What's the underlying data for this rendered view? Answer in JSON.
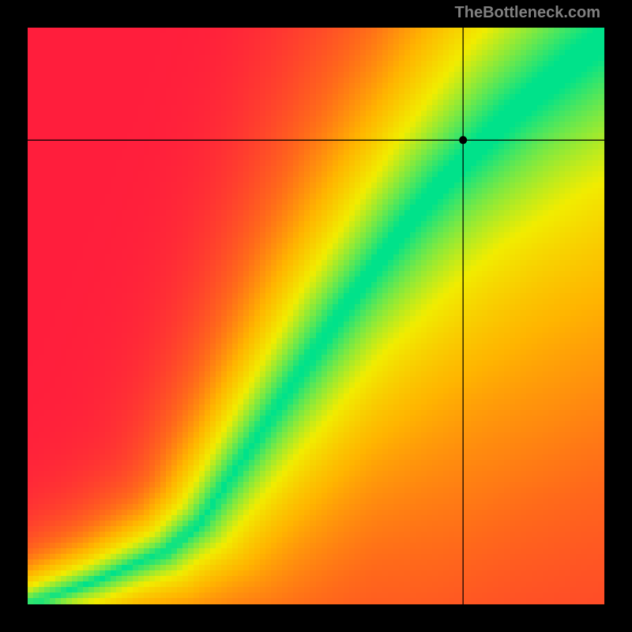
{
  "watermark": "TheBottleneck.com",
  "chart_data": {
    "type": "heatmap",
    "title": "",
    "xlabel": "",
    "ylabel": "",
    "xlim": [
      0,
      100
    ],
    "ylim": [
      0,
      100
    ],
    "crosshair": {
      "x": 75.5,
      "y": 80.5
    },
    "marker": {
      "x": 75.5,
      "y": 80.5
    },
    "optimal_curve_description": "Green optimal band runs diagonally from lower-left to upper-right; narrow at the bottom, widening toward the top. Field grades from red (far from band) through orange/yellow to green (on band).",
    "optimal_curve_points": [
      {
        "x": 0,
        "y": 0
      },
      {
        "x": 6,
        "y": 2
      },
      {
        "x": 12,
        "y": 4
      },
      {
        "x": 18,
        "y": 6.5
      },
      {
        "x": 24,
        "y": 9
      },
      {
        "x": 30,
        "y": 14
      },
      {
        "x": 36,
        "y": 23
      },
      {
        "x": 42,
        "y": 32
      },
      {
        "x": 48,
        "y": 41
      },
      {
        "x": 54,
        "y": 50
      },
      {
        "x": 60,
        "y": 58
      },
      {
        "x": 66,
        "y": 66
      },
      {
        "x": 72,
        "y": 73
      },
      {
        "x": 78,
        "y": 79
      },
      {
        "x": 84,
        "y": 85
      },
      {
        "x": 90,
        "y": 90
      },
      {
        "x": 96,
        "y": 95
      },
      {
        "x": 100,
        "y": 98
      }
    ],
    "band_half_width_points": [
      {
        "x": 0,
        "w": 0.6
      },
      {
        "x": 10,
        "w": 0.9
      },
      {
        "x": 20,
        "w": 1.3
      },
      {
        "x": 30,
        "w": 2.0
      },
      {
        "x": 40,
        "w": 3.0
      },
      {
        "x": 50,
        "w": 4.0
      },
      {
        "x": 60,
        "w": 5.0
      },
      {
        "x": 70,
        "w": 6.5
      },
      {
        "x": 80,
        "w": 8.0
      },
      {
        "x": 90,
        "w": 9.5
      },
      {
        "x": 100,
        "w": 11.0
      }
    ],
    "color_stops": [
      {
        "t": 0.0,
        "color": "#00e28a"
      },
      {
        "t": 0.18,
        "color": "#7ee941"
      },
      {
        "t": 0.35,
        "color": "#f1ec00"
      },
      {
        "t": 0.55,
        "color": "#ffb400"
      },
      {
        "t": 0.75,
        "color": "#ff6a1a"
      },
      {
        "t": 1.0,
        "color": "#ff1e3c"
      }
    ],
    "grid_resolution": 104
  }
}
